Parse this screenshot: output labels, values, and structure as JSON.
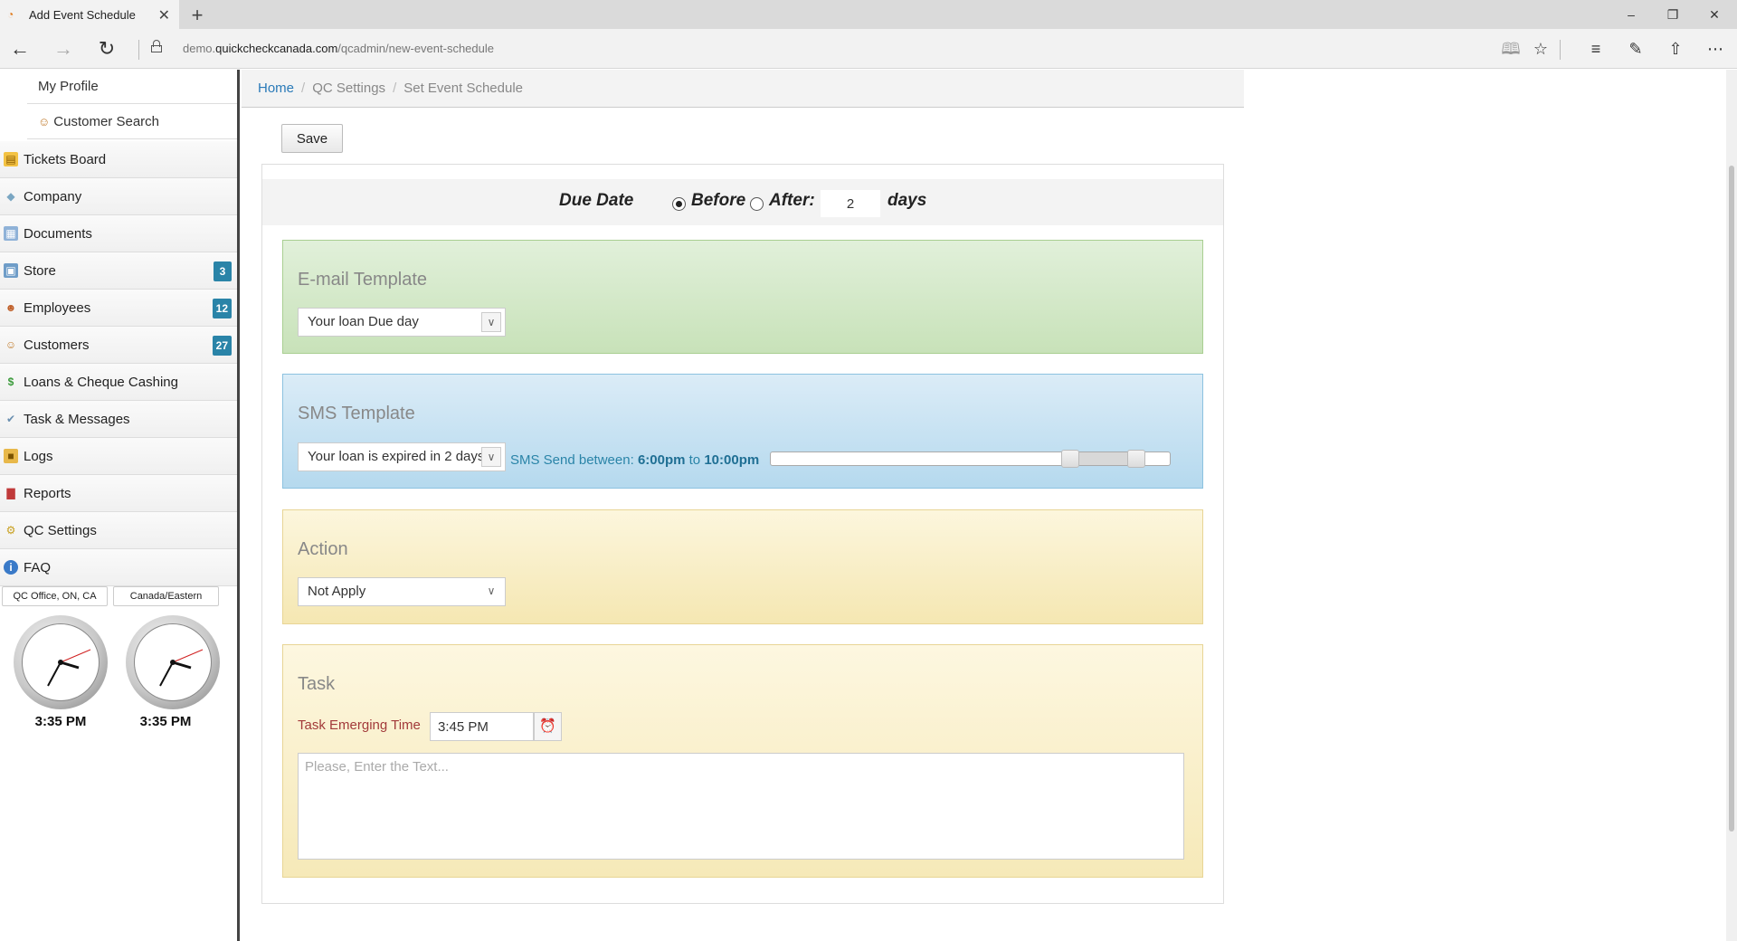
{
  "browser": {
    "tab_title": "Add Event Schedule",
    "url_prefix": "demo.",
    "url_domain": "quickcheckcanada.com",
    "url_path": "/qcadmin/new-event-schedule"
  },
  "sidebar": {
    "sub_items": [
      {
        "label": "My Profile",
        "icon": "user-icon"
      },
      {
        "label": "Customer Search",
        "icon": "users-search-icon"
      }
    ],
    "items": [
      {
        "label": "Tickets Board",
        "icon": "ticket-icon"
      },
      {
        "label": "Company",
        "icon": "tag-icon"
      },
      {
        "label": "Documents",
        "icon": "documents-icon"
      },
      {
        "label": "Store",
        "icon": "store-icon",
        "badge": "3"
      },
      {
        "label": "Employees",
        "icon": "employee-icon",
        "badge": "12"
      },
      {
        "label": "Customers",
        "icon": "customers-icon",
        "badge": "27"
      },
      {
        "label": "Loans & Cheque Cashing",
        "icon": "dollar-icon"
      },
      {
        "label": "Task & Messages",
        "icon": "task-icon"
      },
      {
        "label": "Logs",
        "icon": "box-icon"
      },
      {
        "label": "Reports",
        "icon": "chart-icon"
      },
      {
        "label": "QC Settings",
        "icon": "gear-icon"
      },
      {
        "label": "FAQ",
        "icon": "info-icon"
      }
    ],
    "clocks": [
      {
        "zone": "QC Office, ON, CA",
        "time": "3:35 PM"
      },
      {
        "zone": "Canada/Eastern",
        "time": "3:35 PM"
      }
    ]
  },
  "breadcrumb": {
    "home": "Home",
    "section": "QC Settings",
    "current": "Set Event Schedule"
  },
  "toolbar": {
    "save_label": "Save"
  },
  "due": {
    "label": "Due Date",
    "before_label": "Before",
    "after_label": "After:",
    "selected": "before",
    "days_value": "2",
    "days_label": "days"
  },
  "email": {
    "title": "E-mail Template",
    "selected": "Your loan Due day"
  },
  "sms": {
    "title": "SMS Template",
    "selected": "Your loan is expired in 2 days",
    "send_between_label": "SMS Send between:",
    "from": "6:00pm",
    "to_label": "to",
    "to": "10:00pm",
    "range_start_fraction": 0.75,
    "range_end_fraction": 0.917
  },
  "action": {
    "title": "Action",
    "selected": "Not Apply"
  },
  "task": {
    "title": "Task",
    "time_label": "Task Emerging Time",
    "time_value": "3:45 PM",
    "text_placeholder": "Please, Enter the Text..."
  }
}
